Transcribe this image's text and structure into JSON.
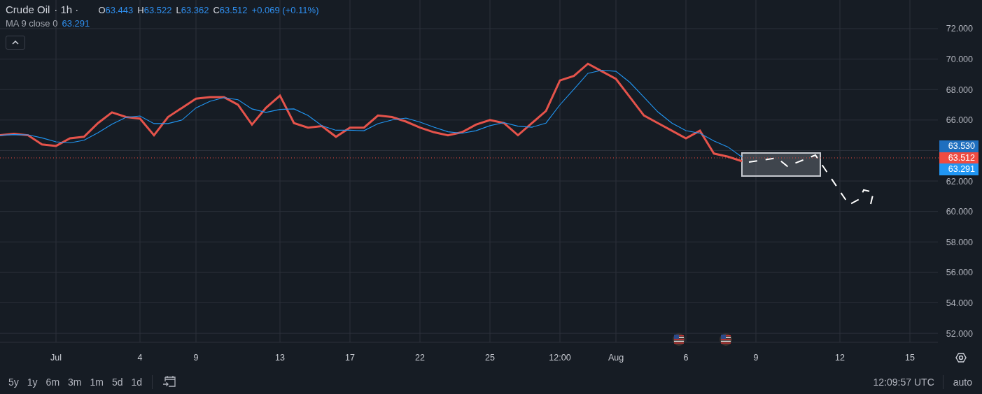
{
  "legend": {
    "interval": "· 1h ·",
    "ohlc": [
      {
        "key": "O",
        "value": "63.443"
      },
      {
        "key": "H",
        "value": "63.522"
      },
      {
        "key": "L",
        "value": "63.362"
      },
      {
        "key": "C",
        "value": "63.512"
      }
    ],
    "change": "+0.069 (+0.11%)",
    "indicator_value": "63.291"
  },
  "chart": {
    "chart_data": {
      "type": "line",
      "categories": [
        null,
        null,
        null,
        null,
        "Jul",
        null,
        null,
        null,
        null,
        null,
        "4",
        null,
        null,
        null,
        "9",
        null,
        null,
        null,
        null,
        null,
        "13",
        null,
        null,
        null,
        null,
        "17",
        null,
        null,
        null,
        null,
        "22",
        null,
        null,
        null,
        null,
        "25",
        null,
        null,
        null,
        null,
        "12:00",
        null,
        null,
        null,
        "Aug",
        null,
        null,
        null,
        null,
        "6",
        null,
        null,
        null,
        null,
        "9",
        null,
        null,
        null,
        null,
        null,
        "12",
        null,
        null,
        null,
        null,
        "15",
        null,
        null
      ],
      "series": [
        {
          "name": "Crude Oil",
          "color": "#e5534b",
          "values": [
            65.0,
            65.1,
            65.0,
            64.4,
            64.3,
            64.8,
            64.9,
            65.8,
            66.5,
            66.2,
            66.1,
            65.0,
            66.2,
            66.8,
            67.4,
            67.5,
            67.5,
            67.0,
            65.7,
            66.8,
            67.6,
            65.8,
            65.5,
            65.6,
            64.9,
            65.5,
            65.5,
            66.3,
            66.2,
            65.9,
            65.5,
            65.2,
            65.0,
            65.2,
            65.7,
            66.0,
            65.8,
            65.0,
            65.8,
            66.6,
            68.6,
            68.9,
            69.7,
            69.2,
            68.7,
            67.5,
            66.3,
            65.8,
            65.3,
            64.8,
            65.3,
            63.8,
            63.6,
            63.3,
            null,
            null,
            null,
            null,
            null,
            null,
            null,
            null,
            null,
            null,
            null,
            null,
            null,
            null
          ]
        },
        {
          "name": "MA 9 close 0",
          "color": "#2196f3",
          "values": [
            65.0,
            65.05,
            65.03,
            64.83,
            64.57,
            64.5,
            64.67,
            65.17,
            65.73,
            66.17,
            66.27,
            65.77,
            65.77,
            66.0,
            66.8,
            67.23,
            67.47,
            67.33,
            66.73,
            66.5,
            66.7,
            66.73,
            66.3,
            65.63,
            65.33,
            65.33,
            65.3,
            65.77,
            66.0,
            66.13,
            65.87,
            65.53,
            65.23,
            65.13,
            65.3,
            65.63,
            65.83,
            65.6,
            65.53,
            65.8,
            67.0,
            68.03,
            69.07,
            69.27,
            69.2,
            68.47,
            67.5,
            66.53,
            65.8,
            65.3,
            65.13,
            64.63,
            64.23,
            63.57,
            null,
            null,
            null,
            null,
            null,
            null,
            null,
            null,
            null,
            null,
            null,
            null,
            null,
            null
          ]
        }
      ],
      "ylim": [
        51.41,
        73.88
      ],
      "grid": true,
      "yticks": [
        {
          "value": 72,
          "label": "72.000"
        },
        {
          "value": 70,
          "label": "70.000"
        },
        {
          "value": 68,
          "label": "68.000"
        },
        {
          "value": 66,
          "label": "66.000"
        },
        {
          "value": 62,
          "label": "62.000"
        },
        {
          "value": 60,
          "label": "60.000"
        },
        {
          "value": 58,
          "label": "58.000"
        },
        {
          "value": 56,
          "label": "56.000"
        },
        {
          "value": 54,
          "label": "54.000"
        },
        {
          "value": 52,
          "label": "52.000"
        }
      ]
    },
    "price_labels": [
      {
        "text": "63.530",
        "color": "#1f6fbf"
      },
      {
        "text": "63.512",
        "color": "#ef4b41"
      },
      {
        "text": "63.291",
        "color": "#2196f3"
      }
    ],
    "events": [
      {
        "kind": "flag"
      },
      {
        "kind": "flag"
      }
    ]
  },
  "toolbar": {
    "ranges": [
      "5y",
      "1y",
      "6m",
      "3m",
      "1m",
      "5d",
      "1d"
    ],
    "clock": "12:09:57 UTC",
    "scale": "auto"
  }
}
